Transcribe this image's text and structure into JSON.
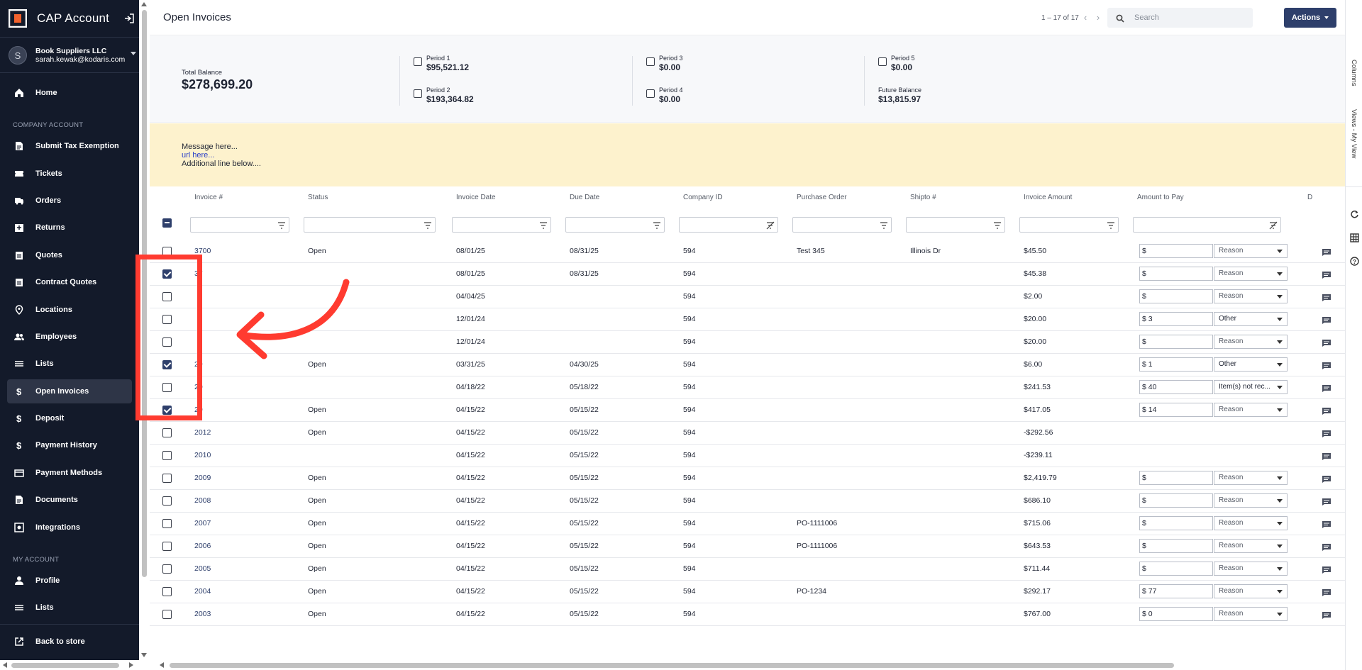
{
  "sidebar": {
    "app_title": "CAP Account",
    "user": {
      "initial": "S",
      "company": "Book Suppliers LLC",
      "email": "sarah.kewak@kodaris.com"
    },
    "company_section": "COMPANY ACCOUNT",
    "my_section": "MY ACCOUNT",
    "items": [
      {
        "label": "Home",
        "icon": "home-icon"
      },
      {
        "label": "Submit Tax Exemption",
        "icon": "document-icon"
      },
      {
        "label": "Tickets",
        "icon": "ticket-icon"
      },
      {
        "label": "Orders",
        "icon": "truck-icon"
      },
      {
        "label": "Returns",
        "icon": "return-icon"
      },
      {
        "label": "Quotes",
        "icon": "clipboard-icon"
      },
      {
        "label": "Contract Quotes",
        "icon": "clipboard-icon"
      },
      {
        "label": "Locations",
        "icon": "location-pin-icon"
      },
      {
        "label": "Employees",
        "icon": "people-icon"
      },
      {
        "label": "Lists",
        "icon": "list-icon"
      },
      {
        "label": "Open Invoices",
        "icon": "dollar-icon"
      },
      {
        "label": "Deposit",
        "icon": "dollar-icon"
      },
      {
        "label": "Payment History",
        "icon": "dollar-icon"
      },
      {
        "label": "Payment Methods",
        "icon": "card-icon"
      },
      {
        "label": "Documents",
        "icon": "document-icon"
      },
      {
        "label": "Integrations",
        "icon": "integration-icon"
      },
      {
        "label": "Profile",
        "icon": "person-icon"
      },
      {
        "label": "Lists",
        "icon": "list-icon"
      },
      {
        "label": "Back to store",
        "icon": "external-link-icon"
      }
    ]
  },
  "header": {
    "title": "Open Invoices",
    "pager": "1 – 17 of 17",
    "search_placeholder": "Search",
    "actions_label": "Actions"
  },
  "summary": {
    "total_label": "Total Balance",
    "total_value": "$278,699.20",
    "periods": [
      {
        "label": "Period 1",
        "value": "$95,521.12"
      },
      {
        "label": "Period 2",
        "value": "$193,364.82"
      },
      {
        "label": "Period 3",
        "value": "$0.00"
      },
      {
        "label": "Period 4",
        "value": "$0.00"
      },
      {
        "label": "Period 5",
        "value": "$0.00"
      }
    ],
    "future_label": "Future Balance",
    "future_value": "$13,815.97"
  },
  "banner": {
    "line1": "Message here...",
    "line2": "url here...",
    "line3": "Additional line below...."
  },
  "grid": {
    "columns": [
      "Invoice #",
      "Status",
      "Invoice Date",
      "Due Date",
      "Company ID",
      "Purchase Order",
      "Shipto #",
      "Invoice Amount",
      "Amount to Pay",
      "D"
    ],
    "rows": [
      {
        "checked": false,
        "invoice": "3700",
        "status": "Open",
        "invoice_date": "08/01/25",
        "due_date": "08/31/25",
        "company": "594",
        "po": "Test 345",
        "shipto": "Illinois Dr",
        "amount": "$45.50",
        "pay": "$",
        "reason": "Reason",
        "editable": true
      },
      {
        "checked": true,
        "invoice": "37",
        "status": "",
        "invoice_date": "08/01/25",
        "due_date": "08/31/25",
        "company": "594",
        "po": "",
        "shipto": "",
        "amount": "$45.38",
        "pay": "$",
        "reason": "Reason",
        "editable": true
      },
      {
        "checked": false,
        "invoice": "",
        "status": "",
        "invoice_date": "04/04/25",
        "due_date": "",
        "company": "594",
        "po": "",
        "shipto": "",
        "amount": "$2.00",
        "pay": "$",
        "reason": "Reason",
        "editable": true
      },
      {
        "checked": false,
        "invoice": "",
        "status": "",
        "invoice_date": "12/01/24",
        "due_date": "",
        "company": "594",
        "po": "",
        "shipto": "",
        "amount": "$20.00",
        "pay": "$ 3",
        "reason": "Other",
        "editable": true
      },
      {
        "checked": false,
        "invoice": "",
        "status": "",
        "invoice_date": "12/01/24",
        "due_date": "",
        "company": "594",
        "po": "",
        "shipto": "",
        "amount": "$20.00",
        "pay": "$",
        "reason": "Reason",
        "editable": true
      },
      {
        "checked": true,
        "invoice": "29",
        "status": "Open",
        "invoice_date": "03/31/25",
        "due_date": "04/30/25",
        "company": "594",
        "po": "",
        "shipto": "",
        "amount": "$6.00",
        "pay": "$ 1",
        "reason": "Other",
        "editable": true
      },
      {
        "checked": false,
        "invoice": "20",
        "status": "",
        "invoice_date": "04/18/22",
        "due_date": "05/18/22",
        "company": "594",
        "po": "",
        "shipto": "",
        "amount": "$241.53",
        "pay": "$ 40",
        "reason": "Item(s) not rec...",
        "editable": true
      },
      {
        "checked": true,
        "invoice": "20",
        "status": "Open",
        "invoice_date": "04/15/22",
        "due_date": "05/15/22",
        "company": "594",
        "po": "",
        "shipto": "",
        "amount": "$417.05",
        "pay": "$ 14",
        "reason": "Reason",
        "editable": true
      },
      {
        "checked": false,
        "invoice": "2012",
        "status": "Open",
        "invoice_date": "04/15/22",
        "due_date": "05/15/22",
        "company": "594",
        "po": "",
        "shipto": "",
        "amount": "-$292.56",
        "pay": "",
        "reason": "",
        "editable": false
      },
      {
        "checked": false,
        "invoice": "2010",
        "status": "",
        "invoice_date": "04/15/22",
        "due_date": "05/15/22",
        "company": "594",
        "po": "",
        "shipto": "",
        "amount": "-$239.11",
        "pay": "",
        "reason": "",
        "editable": false
      },
      {
        "checked": false,
        "invoice": "2009",
        "status": "Open",
        "invoice_date": "04/15/22",
        "due_date": "05/15/22",
        "company": "594",
        "po": "",
        "shipto": "",
        "amount": "$2,419.79",
        "pay": "$",
        "reason": "Reason",
        "editable": true
      },
      {
        "checked": false,
        "invoice": "2008",
        "status": "Open",
        "invoice_date": "04/15/22",
        "due_date": "05/15/22",
        "company": "594",
        "po": "",
        "shipto": "",
        "amount": "$686.10",
        "pay": "$",
        "reason": "Reason",
        "editable": true
      },
      {
        "checked": false,
        "invoice": "2007",
        "status": "Open",
        "invoice_date": "04/15/22",
        "due_date": "05/15/22",
        "company": "594",
        "po": "PO-1111006",
        "shipto": "",
        "amount": "$715.06",
        "pay": "$",
        "reason": "Reason",
        "editable": true
      },
      {
        "checked": false,
        "invoice": "2006",
        "status": "Open",
        "invoice_date": "04/15/22",
        "due_date": "05/15/22",
        "company": "594",
        "po": "PO-1111006",
        "shipto": "",
        "amount": "$643.53",
        "pay": "$",
        "reason": "Reason",
        "editable": true
      },
      {
        "checked": false,
        "invoice": "2005",
        "status": "Open",
        "invoice_date": "04/15/22",
        "due_date": "05/15/22",
        "company": "594",
        "po": "",
        "shipto": "",
        "amount": "$711.44",
        "pay": "$",
        "reason": "Reason",
        "editable": true
      },
      {
        "checked": false,
        "invoice": "2004",
        "status": "Open",
        "invoice_date": "04/15/22",
        "due_date": "05/15/22",
        "company": "594",
        "po": "PO-1234",
        "shipto": "",
        "amount": "$292.17",
        "pay": "$ 77",
        "reason": "Reason",
        "editable": true
      },
      {
        "checked": false,
        "invoice": "2003",
        "status": "Open",
        "invoice_date": "04/15/22",
        "due_date": "05/15/22",
        "company": "594",
        "po": "",
        "shipto": "",
        "amount": "$767.00",
        "pay": "$ 0",
        "reason": "Reason",
        "editable": true
      }
    ]
  },
  "rail": {
    "columns": "Columns",
    "views": "Views - My View"
  },
  "colors": {
    "sidebar_bg": "#131a2a",
    "accent": "#2e3f6b",
    "banner_bg": "#fdf2cd",
    "annotation": "#ff3b30"
  }
}
